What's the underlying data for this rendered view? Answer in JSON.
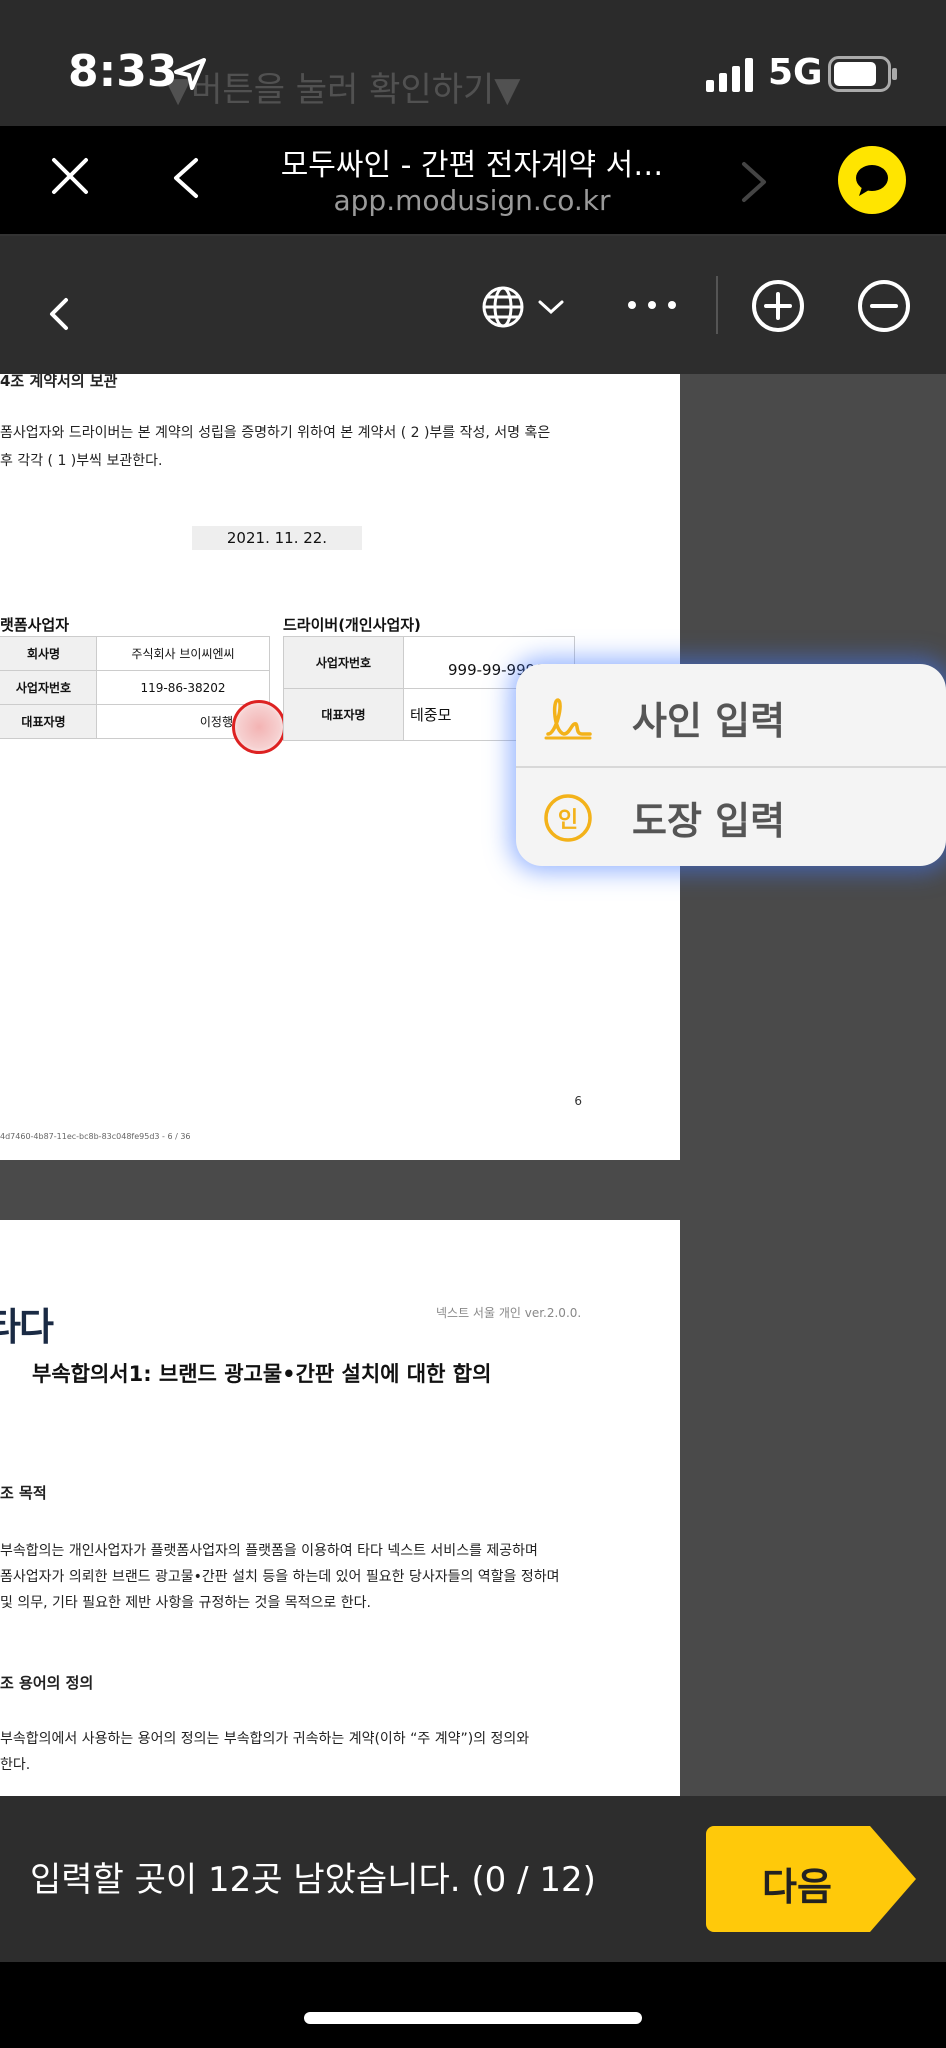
{
  "status_bar": {
    "ghost_text": "▼버튼을 눌러 확인하기▼",
    "time": "8:33",
    "network": "5G"
  },
  "browser": {
    "title": "모두싸인 - 간편 전자계약 서…",
    "url": "app.modusign.co.kr"
  },
  "page1": {
    "heading": "4조 계약서의 보관",
    "para_line1": "폼사업자와 드라이버는 본 계약의 성립을 증명하기 위하여 본 계약서 ( 2 )부를 작성, 서명 혹은",
    "para_line2": "후 각각 ( 1 )부씩 보관한다.",
    "date": "2021. 11. 22.",
    "left_party": {
      "title": "랫폼사업자",
      "rows": [
        {
          "key": "회사명",
          "value": "주식회사 브이씨엔씨"
        },
        {
          "key": "사업자번호",
          "value": "119-86-38202"
        },
        {
          "key": "대표자명",
          "value": "이정행"
        }
      ]
    },
    "right_party": {
      "title": "드라이버(개인사업자)",
      "rows": [
        {
          "key": "사업자번호",
          "value": "999-99-99999"
        },
        {
          "key": "대표자명",
          "value": "테중모"
        }
      ]
    },
    "page_number": "6",
    "doc_id": "4d7460-4b87-11ec-bc8b-83c048fe95d3 - 6 / 36"
  },
  "page2": {
    "logo": "타다",
    "version": "넥스트 서울 개인 ver.2.0.0.",
    "title": "부속합의서1: 브랜드 광고물•간판 설치에 대한 합의",
    "sec1_heading": "조 목적",
    "sec1_line1": "부속합의는 개인사업자가 플랫폼사업자의 플랫폼을 이용하여 타다 넥스트 서비스를 제공하며",
    "sec1_line2": "폼사업자가 의뢰한 브랜드 광고물•간판 설치 등을 하는데 있어 필요한 당사자들의 역할을 정하며",
    "sec1_line3": "및 의무, 기타 필요한 제반 사항을 규정하는 것을 목적으로 한다.",
    "sec2_heading": "조 용어의 정의",
    "sec2_line1": "부속합의에서 사용하는 용어의 정의는 부속합의가 귀속하는 계약(이하 “주 계약”)의 정의와",
    "sec2_line2": "한다."
  },
  "popover": {
    "signature_label": "사인 입력",
    "stamp_label": "도장 입력",
    "stamp_icon_text": "인"
  },
  "bottom": {
    "remaining_text": "입력할 곳이 12곳 남았습니다. (0 / 12)",
    "next_label": "다음"
  },
  "colors": {
    "accent_yellow": "#FFC90A",
    "kakao_yellow": "#FFE500",
    "popover_glow": "#4278FF"
  },
  "icons": [
    "location-arrow-icon",
    "signal-icon",
    "battery-icon",
    "close-icon",
    "back-icon",
    "forward-icon",
    "chat-bubble-icon",
    "chevron-left-icon",
    "globe-icon",
    "chevron-down-icon",
    "more-icon",
    "zoom-in-icon",
    "zoom-out-icon",
    "signature-icon",
    "stamp-icon"
  ]
}
